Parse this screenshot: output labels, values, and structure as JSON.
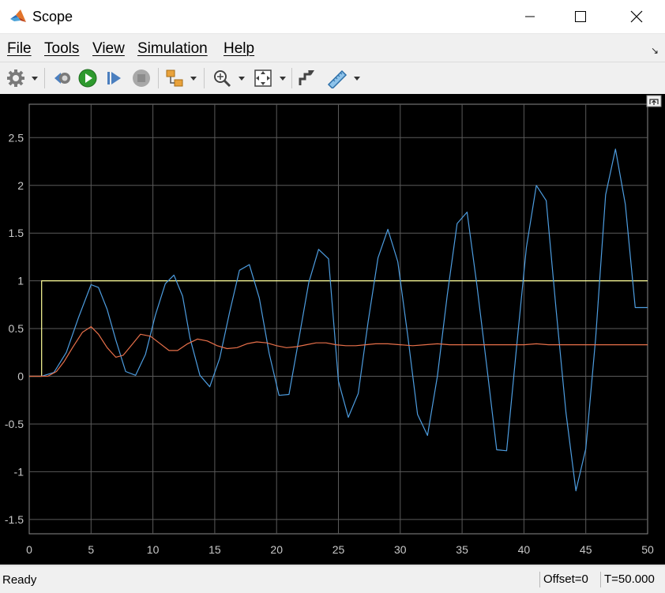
{
  "window": {
    "title": "Scope"
  },
  "menu": [
    "File",
    "Tools",
    "View",
    "Simulation",
    "Help"
  ],
  "status": {
    "text": "Ready",
    "offset": "Offset=0",
    "time": "T=50.000"
  },
  "colors": {
    "plot_bg": "#000000",
    "grid": "#5a5a5a",
    "tick_text": "#c8c8c8",
    "series_yellow": "#ffff99",
    "series_blue": "#4d9de0",
    "series_red": "#e8704a",
    "run_green": "#2e9a2e"
  },
  "icons": [
    "settings-gear-icon",
    "step-back-icon",
    "run-icon",
    "step-forward-icon",
    "stop-icon",
    "highlight-block-icon",
    "zoom-icon",
    "autoscale-icon",
    "data-cursor-icon",
    "measurements-icon",
    "undock-icon"
  ],
  "chart_data": {
    "type": "line",
    "title": "",
    "xlabel": "",
    "ylabel": "",
    "xlim": [
      0,
      50
    ],
    "ylim": [
      -1.65,
      2.85
    ],
    "xticks": [
      0,
      5,
      10,
      15,
      20,
      25,
      30,
      35,
      40,
      45,
      50
    ],
    "yticks": [
      -1.5,
      -1,
      -0.5,
      0,
      0.5,
      1,
      1.5,
      2,
      2.5
    ],
    "grid": true,
    "series": [
      {
        "color": "#ffff99",
        "x": [
          0,
          1,
          1,
          50
        ],
        "y": [
          0,
          0,
          1,
          1
        ]
      },
      {
        "color": "#4d9de0",
        "x": [
          0,
          1,
          2,
          3,
          4,
          5,
          5.6,
          6.3,
          7,
          7.8,
          8.6,
          9.4,
          10.2,
          11,
          11.7,
          12.4,
          13,
          13.8,
          14.6,
          15.4,
          16.2,
          17,
          17.8,
          18.6,
          19.4,
          20.2,
          21,
          21.8,
          22.6,
          23.4,
          24.2,
          25,
          25.8,
          26.6,
          27.4,
          28.2,
          29,
          29.8,
          30.6,
          31.4,
          32.2,
          33,
          33.8,
          34.6,
          35.4,
          36.2,
          37,
          37.8,
          38.6,
          39.4,
          40.2,
          41,
          41.8,
          42.6,
          43.4,
          44.2,
          45,
          45.8,
          46.6,
          47.4,
          48.2,
          49,
          49.8,
          50
        ],
        "y": [
          0,
          0,
          0.04,
          0.25,
          0.62,
          0.96,
          0.93,
          0.7,
          0.38,
          0.05,
          0.01,
          0.23,
          0.64,
          0.97,
          1.06,
          0.84,
          0.4,
          0.01,
          -0.11,
          0.19,
          0.67,
          1.11,
          1.17,
          0.82,
          0.24,
          -0.2,
          -0.19,
          0.39,
          0.98,
          1.33,
          1.23,
          -0.05,
          -0.43,
          -0.18,
          0.57,
          1.24,
          1.54,
          1.2,
          0.43,
          -0.4,
          -0.62,
          0.0,
          0.85,
          1.6,
          1.72,
          0.95,
          0.1,
          -0.77,
          -0.78,
          0.3,
          1.35,
          2.0,
          1.84,
          0.7,
          -0.38,
          -1.2,
          -0.76,
          0.4,
          1.9,
          2.38,
          1.8,
          0.72,
          0.72,
          0.72
        ]
      },
      {
        "color": "#e8704a",
        "x": [
          0,
          1.5,
          2.2,
          2.8,
          3.5,
          4.3,
          5,
          5.6,
          6.3,
          7,
          7.6,
          8.3,
          9,
          9.8,
          10.5,
          11.3,
          12,
          12.8,
          13.6,
          14.4,
          15.2,
          16,
          16.8,
          17.6,
          18.4,
          19.2,
          20,
          20.8,
          21.6,
          22.4,
          23.2,
          24,
          24.8,
          25.6,
          26.4,
          27.2,
          28,
          29,
          30,
          31,
          32,
          33,
          34,
          35,
          36,
          37,
          38,
          39,
          40,
          41,
          42,
          43,
          44,
          45,
          46,
          47,
          48,
          49,
          50
        ],
        "y": [
          0,
          0,
          0.05,
          0.15,
          0.3,
          0.46,
          0.52,
          0.44,
          0.3,
          0.2,
          0.22,
          0.33,
          0.44,
          0.42,
          0.35,
          0.27,
          0.27,
          0.34,
          0.39,
          0.37,
          0.32,
          0.29,
          0.3,
          0.34,
          0.36,
          0.35,
          0.32,
          0.3,
          0.31,
          0.33,
          0.35,
          0.35,
          0.33,
          0.32,
          0.32,
          0.33,
          0.34,
          0.34,
          0.33,
          0.32,
          0.33,
          0.34,
          0.33,
          0.33,
          0.33,
          0.33,
          0.33,
          0.33,
          0.33,
          0.34,
          0.33,
          0.33,
          0.33,
          0.33,
          0.33,
          0.33,
          0.33,
          0.33,
          0.33
        ]
      }
    ]
  }
}
